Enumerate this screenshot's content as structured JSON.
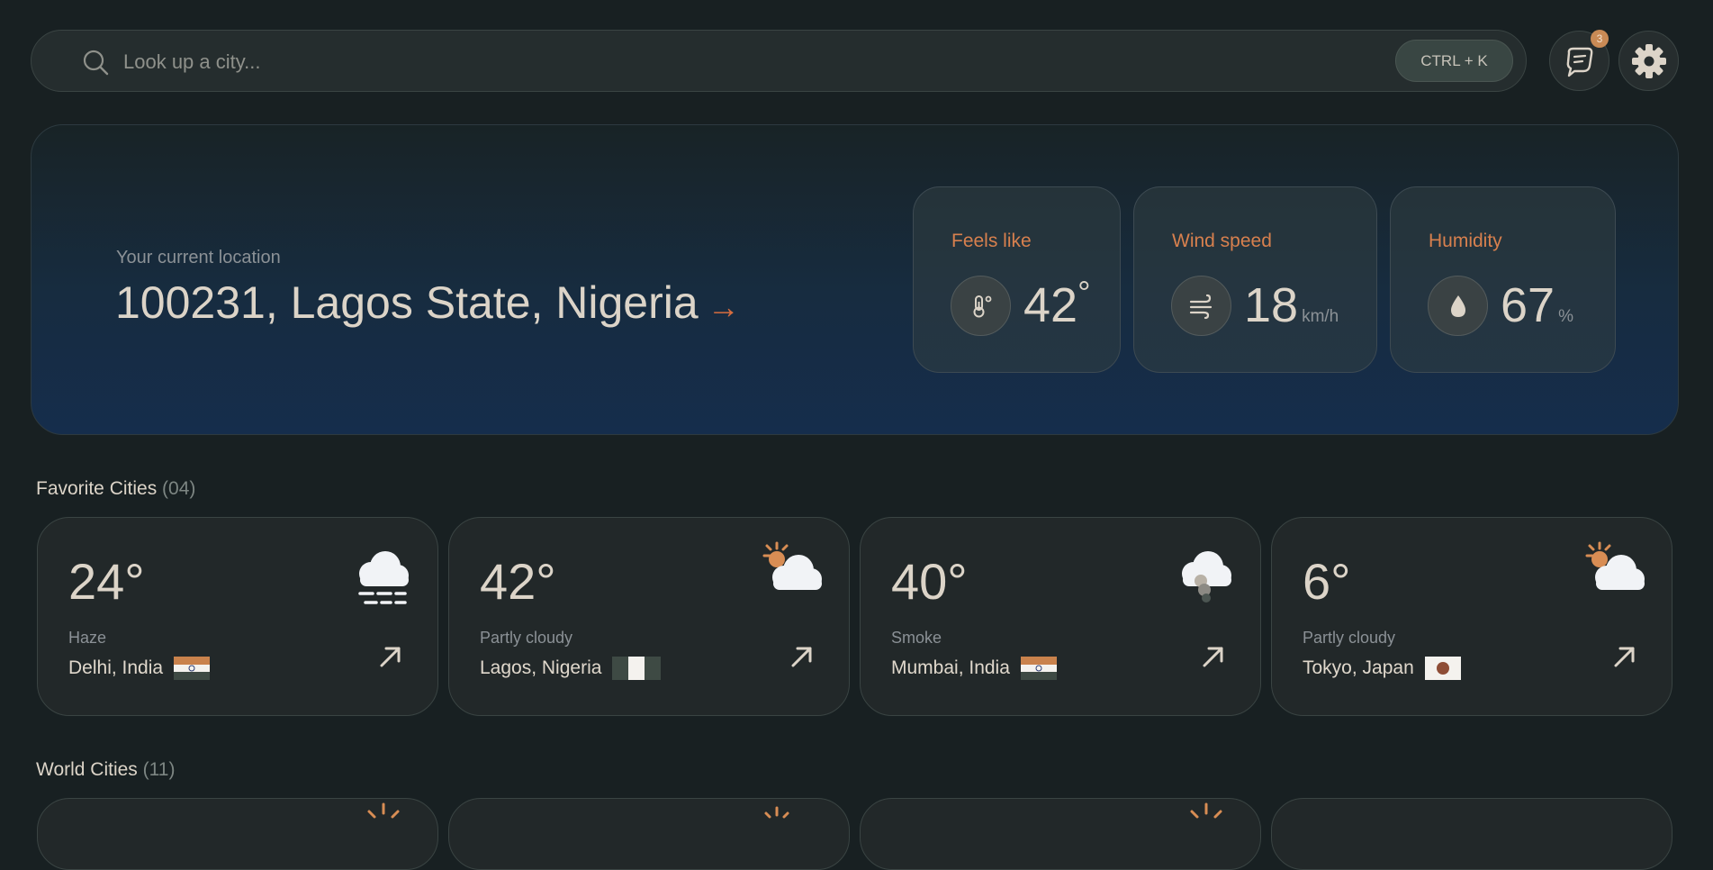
{
  "search": {
    "placeholder": "Look up a city...",
    "shortcut": "CTRL + K"
  },
  "header": {
    "notifications_count": "3"
  },
  "current": {
    "label": "Your current location",
    "location": "100231, Lagos State, Nigeria",
    "arrow": "→",
    "feels_like": {
      "label": "Feels like",
      "value": "42",
      "unit": "°"
    },
    "wind": {
      "label": "Wind speed",
      "value": "18",
      "unit": "km/h"
    },
    "humidity": {
      "label": "Humidity",
      "value": "67",
      "unit": "%"
    }
  },
  "favorites": {
    "title": "Favorite Cities",
    "count": "(04)",
    "cards": [
      {
        "temp": "24°",
        "condition": "Haze",
        "city": "Delhi, India",
        "icon": "haze-icon"
      },
      {
        "temp": "42°",
        "condition": "Partly cloudy",
        "city": "Lagos, Nigeria",
        "icon": "partly-cloudy-icon"
      },
      {
        "temp": "40°",
        "condition": "Smoke",
        "city": "Mumbai, India",
        "icon": "smoke-icon"
      },
      {
        "temp": "6°",
        "condition": "Partly cloudy",
        "city": "Tokyo, Japan",
        "icon": "partly-cloudy-icon"
      }
    ]
  },
  "world": {
    "title": "World Cities",
    "count": "(11)"
  },
  "colors": {
    "background": "#182022",
    "accent": "#d8804e",
    "hero_bottom": "#152d4c"
  }
}
